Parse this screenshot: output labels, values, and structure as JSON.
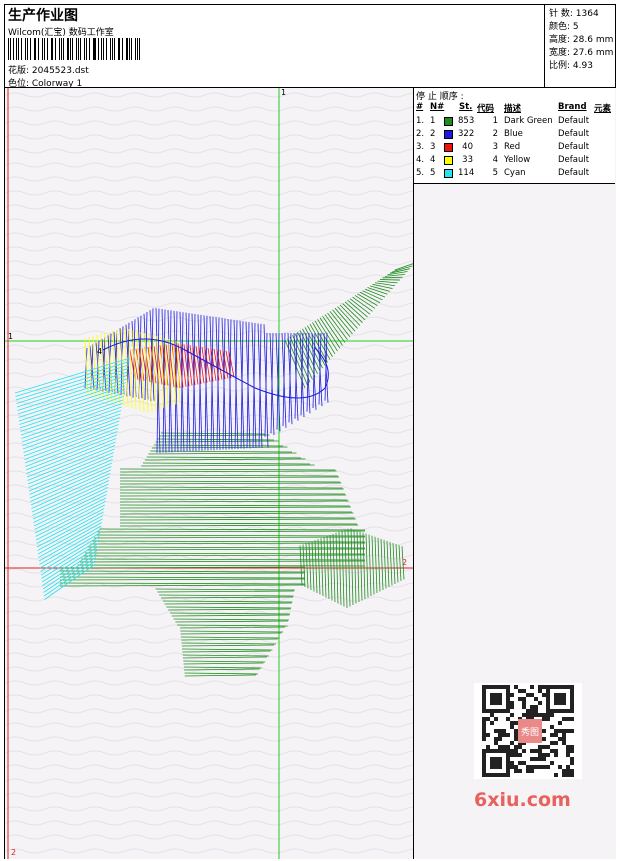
{
  "header": {
    "title": "生产作业图",
    "company": "Wilcom(汇宝) 数码工作室",
    "file_label": "花版: 2045523.dst",
    "colorway_label": "色位: Colorway 1"
  },
  "stats": [
    {
      "label": "针 数",
      "value": "1364"
    },
    {
      "label": "颜色",
      "value": "5"
    },
    {
      "label": "高度",
      "value": "28.6 mm"
    },
    {
      "label": "宽度",
      "value": "27.6 mm"
    },
    {
      "label": "比例",
      "value": "4.93"
    }
  ],
  "legend": {
    "title": "停 止 顺序 :",
    "columns": [
      "#",
      "N#",
      "St.",
      "代码",
      "描述",
      "Brand",
      "元素"
    ],
    "rows": [
      {
        "idx": "1.",
        "n": "1",
        "color": "#1e8c1e",
        "st": "853",
        "code": "1",
        "desc": "Dark Green",
        "brand": "Default"
      },
      {
        "idx": "2.",
        "n": "2",
        "color": "#1a1ae0",
        "st": "322",
        "code": "2",
        "desc": "Blue",
        "brand": "Default"
      },
      {
        "idx": "3.",
        "n": "3",
        "color": "#ee1111",
        "st": "40",
        "code": "3",
        "desc": "Red",
        "brand": "Default"
      },
      {
        "idx": "4.",
        "n": "4",
        "color": "#ffff00",
        "st": "33",
        "code": "4",
        "desc": "Yellow",
        "brand": "Default"
      },
      {
        "idx": "5.",
        "n": "5",
        "color": "#22e4ee",
        "st": "114",
        "code": "5",
        "desc": "Cyan",
        "brand": "Default"
      }
    ]
  },
  "guides": {
    "v_top": "1",
    "h_left": "1",
    "h_right": "2",
    "corner_bottom": "2",
    "small_mark": "4"
  },
  "watermark": {
    "site": "6xiu.com",
    "seal": "秀图"
  },
  "colors": {
    "guide_green": "#22cc22",
    "guide_red": "#dd2222"
  }
}
